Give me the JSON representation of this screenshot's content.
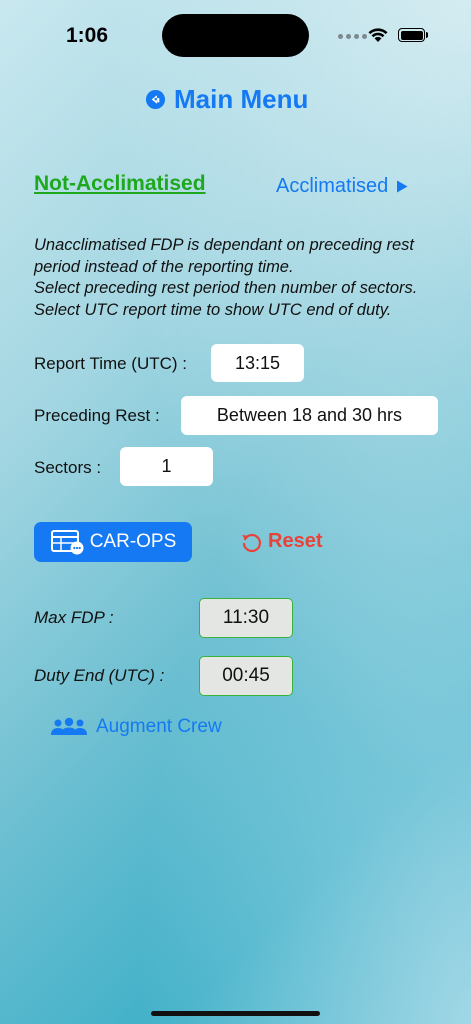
{
  "status_bar": {
    "time": "1:06"
  },
  "header": {
    "main_menu_label": "Main Menu"
  },
  "mode": {
    "active_label": "Not-Acclimatised",
    "other_label": "Acclimatised"
  },
  "description": {
    "line1": "Unacclimatised FDP is dependant on preceding rest period instead of the reporting time.",
    "line2": "Select preceding rest period then number of sectors.",
    "line3": "Select UTC report time to show UTC end of duty."
  },
  "inputs": {
    "report_time_label": "Report Time (UTC) :",
    "report_time_value": "13:15",
    "preceding_rest_label": "Preceding Rest :",
    "preceding_rest_value": "Between 18 and 30 hrs",
    "sectors_label": "Sectors :",
    "sectors_value": "1"
  },
  "actions": {
    "carops_label": "CAR-OPS",
    "reset_label": "Reset"
  },
  "results": {
    "max_fdp_label": "Max FDP :",
    "max_fdp_value": "11:30",
    "duty_end_label": "Duty End (UTC) :",
    "duty_end_value": "00:45"
  },
  "augment": {
    "label": "Augment Crew"
  },
  "colors": {
    "accent": "#1479f3",
    "active": "#1ea81e",
    "reset": "#e8433a"
  }
}
